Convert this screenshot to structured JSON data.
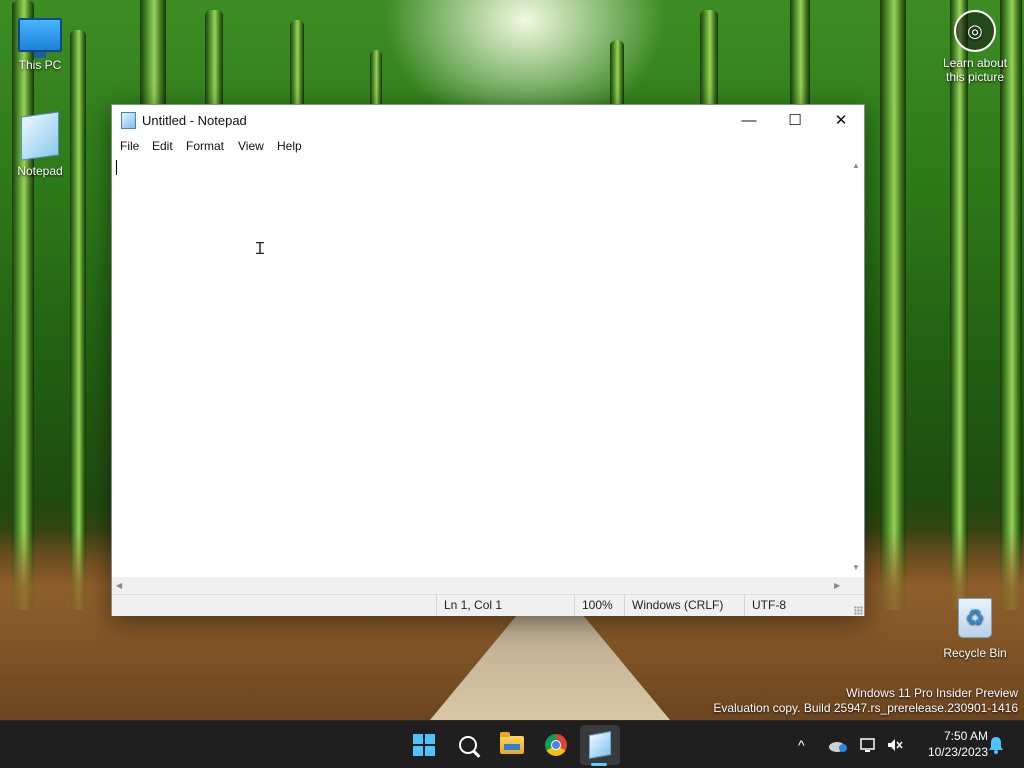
{
  "desktop": {
    "icons": {
      "this_pc": "This PC",
      "notepad": "Notepad",
      "recycle_bin": "Recycle Bin",
      "learn_line1": "Learn about",
      "learn_line2": "this picture"
    },
    "watermark": {
      "line1": "Windows 11 Pro Insider Preview",
      "line2": "Evaluation copy. Build 25947.rs_prerelease.230901-1416"
    }
  },
  "window": {
    "title": "Untitled - Notepad",
    "controls": {
      "minimize": "—",
      "maximize": "☐",
      "close": "✕"
    },
    "menu": [
      "File",
      "Edit",
      "Format",
      "View",
      "Help"
    ],
    "editor": {
      "value": ""
    },
    "status": {
      "position": "Ln 1, Col 1",
      "zoom": "100%",
      "line_ending": "Windows (CRLF)",
      "encoding": "UTF-8"
    }
  },
  "taskbar": {
    "apps": [
      "start-icon",
      "search-icon",
      "file-explorer-icon",
      "chrome-icon",
      "notepad-icon"
    ],
    "active_app": "notepad",
    "tray": {
      "chevron": "^",
      "time": "7:50 AM",
      "date": "10/23/2023"
    },
    "accent_color": "#60cdff"
  }
}
